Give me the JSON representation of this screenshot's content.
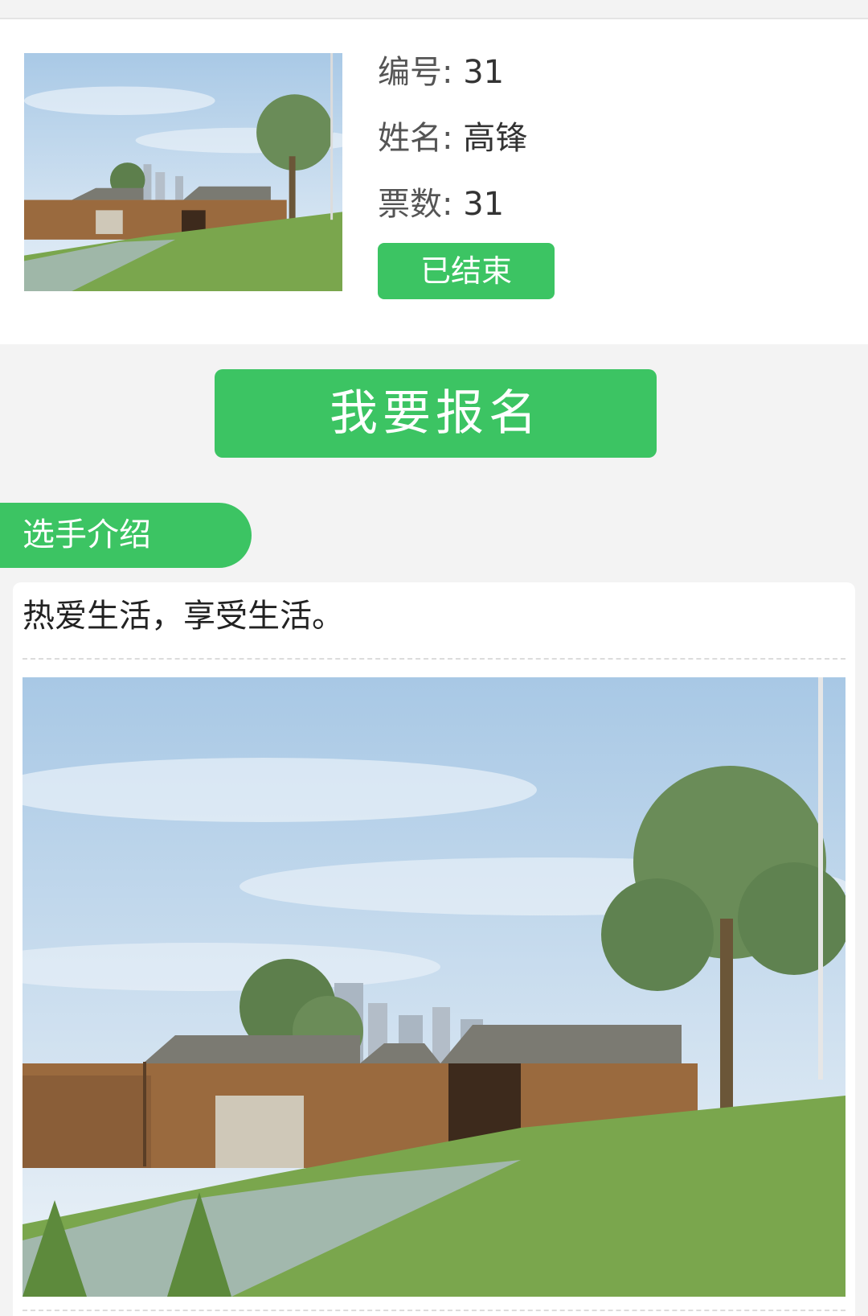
{
  "candidate": {
    "number_label": "编号:",
    "number_value": "31",
    "name_label": "姓名:",
    "name_value": "高锋",
    "votes_label": "票数:",
    "votes_value": "31",
    "status_label": "已结束",
    "photo_icon": "park-wooden-pavilions-photo"
  },
  "actions": {
    "signup_label": "我要报名"
  },
  "intro": {
    "section_title": "选手介绍",
    "text": "热爱生活，享受生活。",
    "photo_icon": "park-wooden-pavilions-photo"
  },
  "colors": {
    "accent": "#3cc463",
    "background": "#f3f3f3",
    "card": "#ffffff"
  }
}
